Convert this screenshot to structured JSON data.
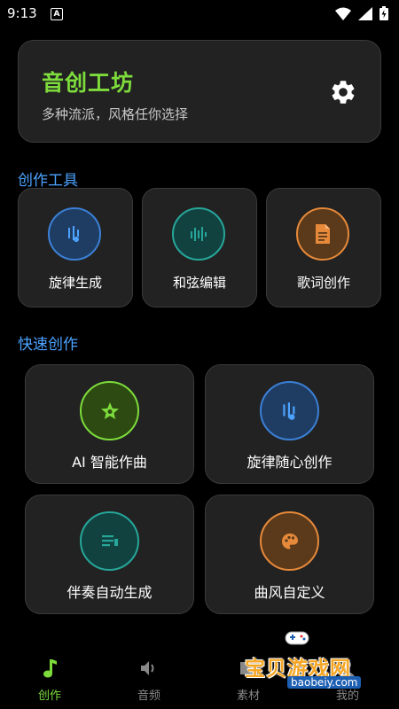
{
  "status": {
    "time": "9:13",
    "notif": "A"
  },
  "header": {
    "title": "音创工坊",
    "subtitle": "多种流派，风格任你选择",
    "settings_icon": "gear-icon"
  },
  "sections": {
    "tools_title": "创作工具",
    "quick_title": "快速创作"
  },
  "tools": [
    {
      "label": "旋律生成",
      "icon": "melody-icon",
      "color": "#4ca3ff"
    },
    {
      "label": "和弦编辑",
      "icon": "waveform-icon",
      "color": "#26a69a"
    },
    {
      "label": "歌词创作",
      "icon": "document-icon",
      "color": "#e6893a"
    }
  ],
  "quick": [
    {
      "label": "AI 智能作曲",
      "icon": "star-icon",
      "color": "#7ddc3b"
    },
    {
      "label": "旋律随心创作",
      "icon": "melody-icon",
      "color": "#4ca3ff"
    },
    {
      "label": "伴奏自动生成",
      "icon": "list-icon",
      "color": "#26a69a"
    },
    {
      "label": "曲风自定义",
      "icon": "palette-icon",
      "color": "#e6893a"
    }
  ],
  "nav": [
    {
      "label": "创作",
      "icon": "music-note-icon",
      "active": true
    },
    {
      "label": "音频",
      "icon": "speaker-icon",
      "active": false
    },
    {
      "label": "素材",
      "icon": "folder-icon",
      "active": false
    },
    {
      "label": "我的",
      "icon": "profile-icon",
      "active": false
    }
  ],
  "watermark": {
    "text": "宝贝游戏网",
    "url": "baobeiy.com"
  }
}
